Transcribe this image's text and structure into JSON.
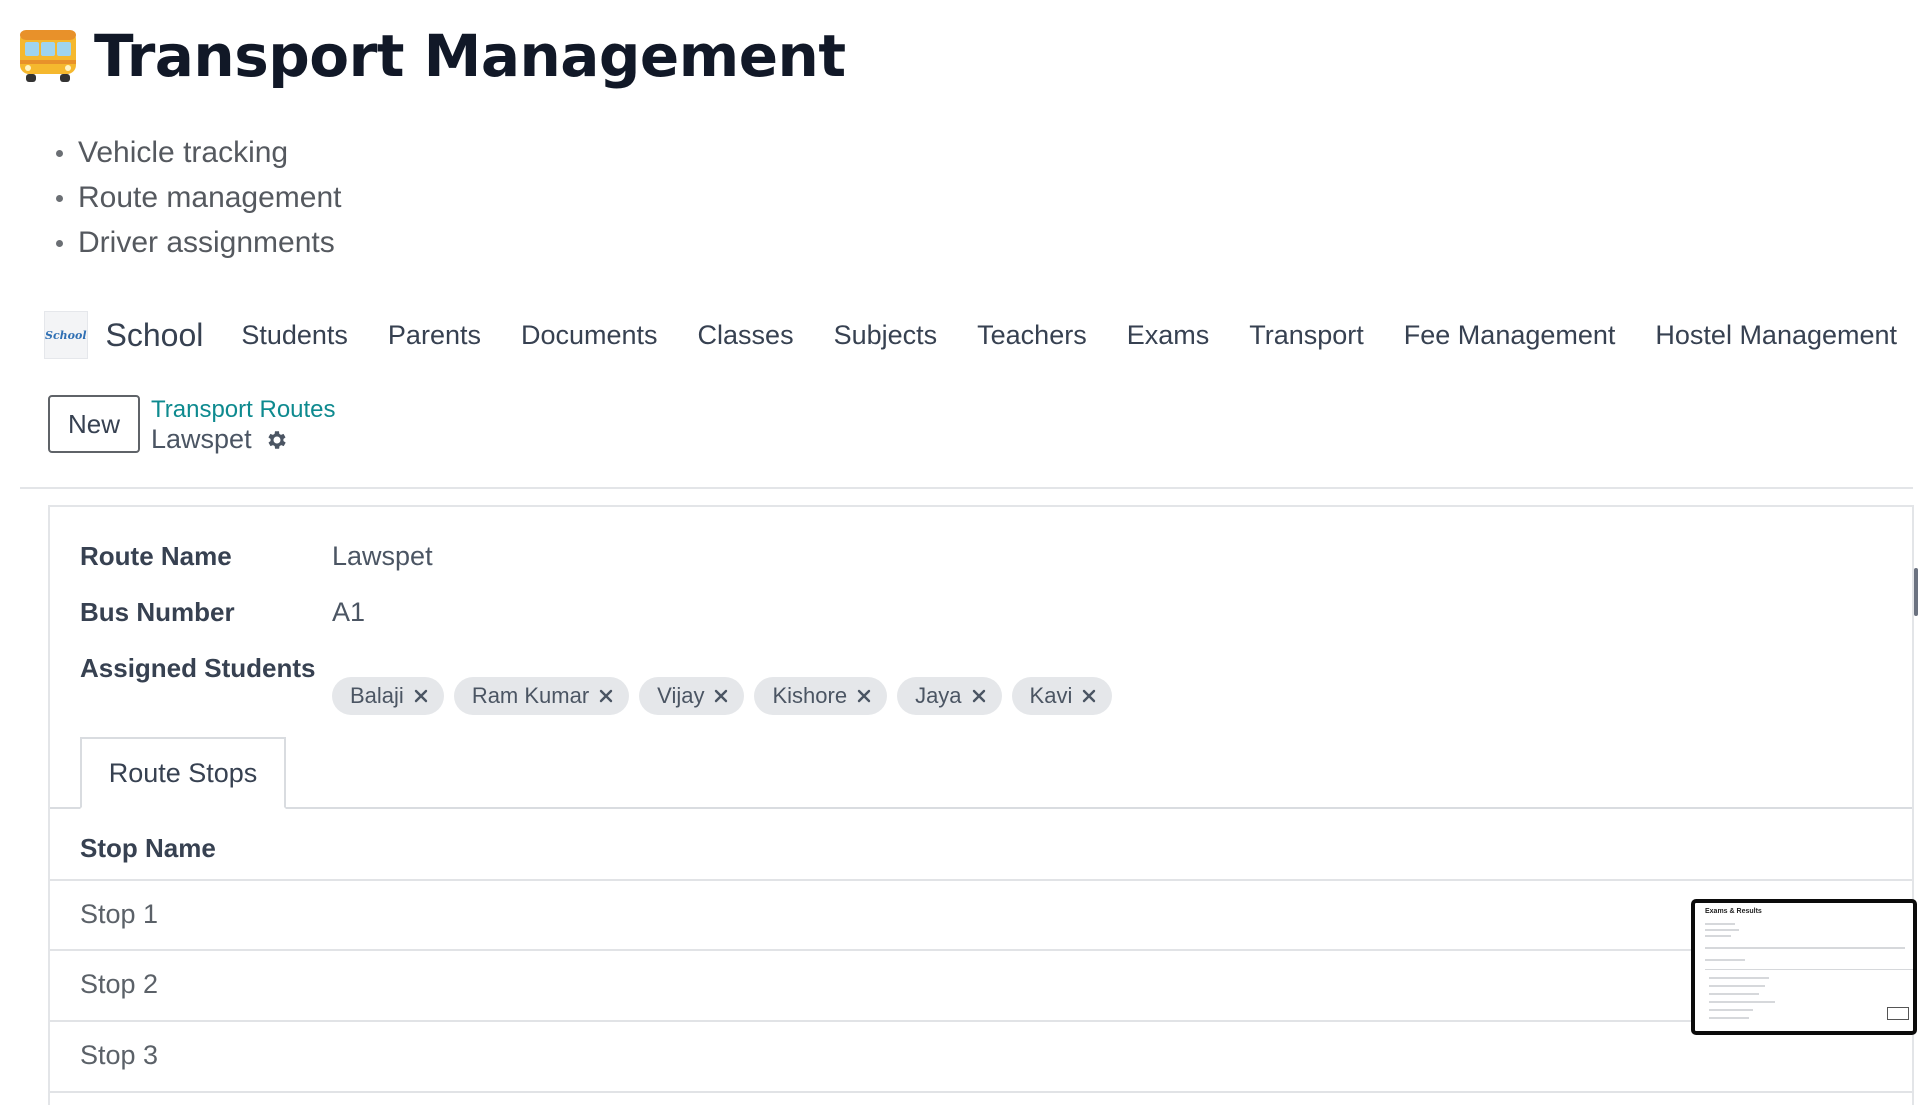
{
  "page": {
    "title": "Transport Management",
    "features": [
      "Vehicle tracking",
      "Route management",
      "Driver assignments"
    ]
  },
  "navbar": {
    "brand_logo_text": "School",
    "brand": "School",
    "items": [
      "Students",
      "Parents",
      "Documents",
      "Classes",
      "Subjects",
      "Teachers",
      "Exams",
      "Transport",
      "Fee Management",
      "Hostel Management"
    ]
  },
  "control_panel": {
    "new_label": "New",
    "breadcrumb": "Transport Routes",
    "record_title": "Lawspet"
  },
  "form": {
    "route_name_label": "Route Name",
    "route_name_value": "Lawspet",
    "bus_number_label": "Bus Number",
    "bus_number_value": "A1",
    "students_label": "Assigned Students",
    "students": [
      "Balaji",
      "Ram Kumar",
      "Vijay",
      "Kishore",
      "Jaya",
      "Kavi"
    ]
  },
  "tabs": {
    "route_stops": "Route Stops"
  },
  "stops_table": {
    "column": "Stop Name",
    "rows": [
      "Stop 1",
      "Stop 2",
      "Stop 3"
    ]
  },
  "thumbnail": {
    "title": "Exams & Results"
  },
  "colors": {
    "accent_link": "#0e8a8f",
    "tag_bg": "#e5e7ea",
    "text": "#374151"
  },
  "icons": {
    "heading": "bus-icon",
    "settings": "gear-icon",
    "tag_remove": "close-icon"
  }
}
